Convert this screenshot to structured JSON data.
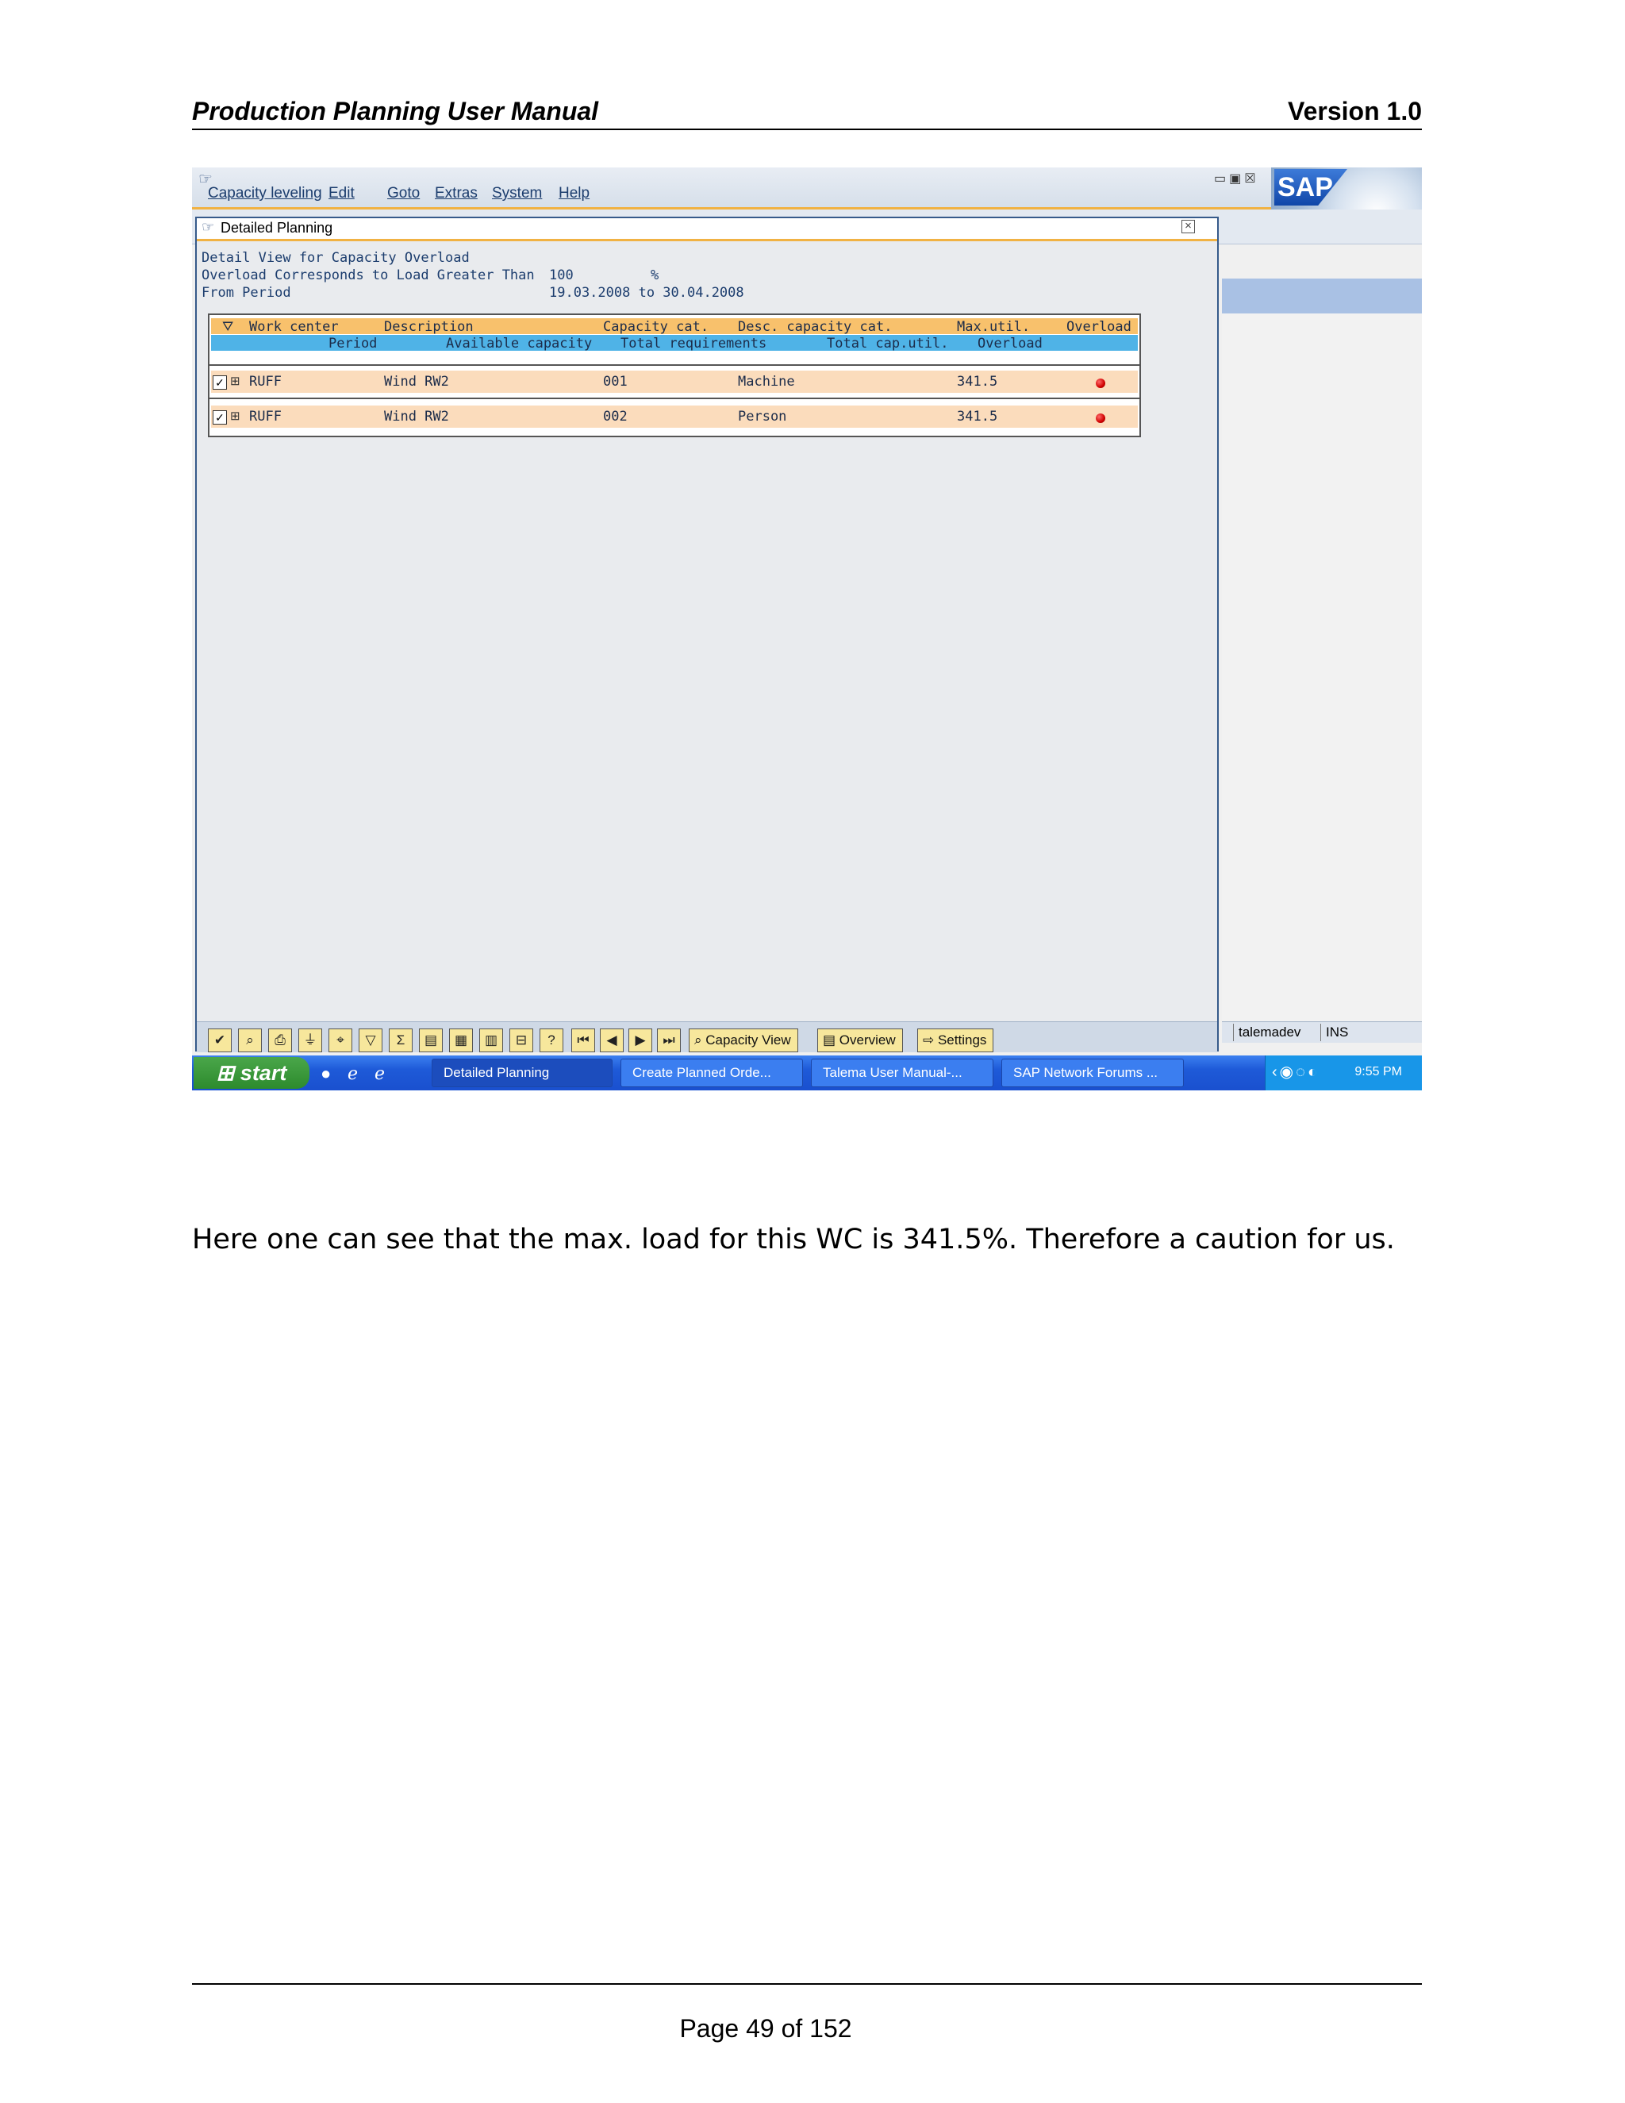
{
  "document": {
    "title": "Production Planning User Manual",
    "version": "Version 1.0",
    "body_text": "Here one can see that the max. load for this WC is 341.5%. Therefore a caution for us.",
    "footer": "Page 49 of 152"
  },
  "sap": {
    "menu": [
      "Capacity leveling",
      "Edit",
      "Goto",
      "Extras",
      "System",
      "Help"
    ],
    "logo": "SAP",
    "popup": {
      "title": "Detailed Planning",
      "info": {
        "line1": "Detail View for Capacity Overload",
        "line2_label": "Overload Corresponds to Load Greater Than",
        "line2_value": "100",
        "line2_unit": "%",
        "line3_label": "From Period",
        "line3_value": "19.03.2008 to 30.04.2008"
      },
      "grid": {
        "header1": [
          "Work center",
          "Description",
          "Capacity cat.",
          "Desc. capacity cat.",
          "Max.util.",
          "Overload"
        ],
        "header2": [
          "Period",
          "Available capacity",
          "Total requirements",
          "Total cap.util.",
          "Overload"
        ],
        "rows": [
          {
            "checked": true,
            "work_center": "RUFF",
            "description": "Wind RW2",
            "cap_cat": "001",
            "desc_cap_cat": "Machine",
            "max_util": "341.5"
          },
          {
            "checked": true,
            "work_center": "RUFF",
            "description": "Wind RW2",
            "cap_cat": "002",
            "desc_cap_cat": "Person",
            "max_util": "341.5"
          }
        ]
      },
      "buttons": {
        "capacity_view": "Capacity View",
        "overview": "Overview",
        "settings": "Settings"
      }
    },
    "status": {
      "system": "talemadev",
      "mode": "INS"
    }
  },
  "taskbar": {
    "start": "start",
    "tasks": [
      "Detailed Planning",
      "Create Planned Orde...",
      "Talema User Manual-...",
      "SAP Network Forums ..."
    ],
    "clock": "9:55 PM"
  },
  "colors": {
    "grid_header1": "#f8c16c",
    "grid_header2": "#4fb3e7",
    "grid_row": "#fbdcbc",
    "overload_alert": "#d00000",
    "taskbar": "#1e5ad8"
  }
}
